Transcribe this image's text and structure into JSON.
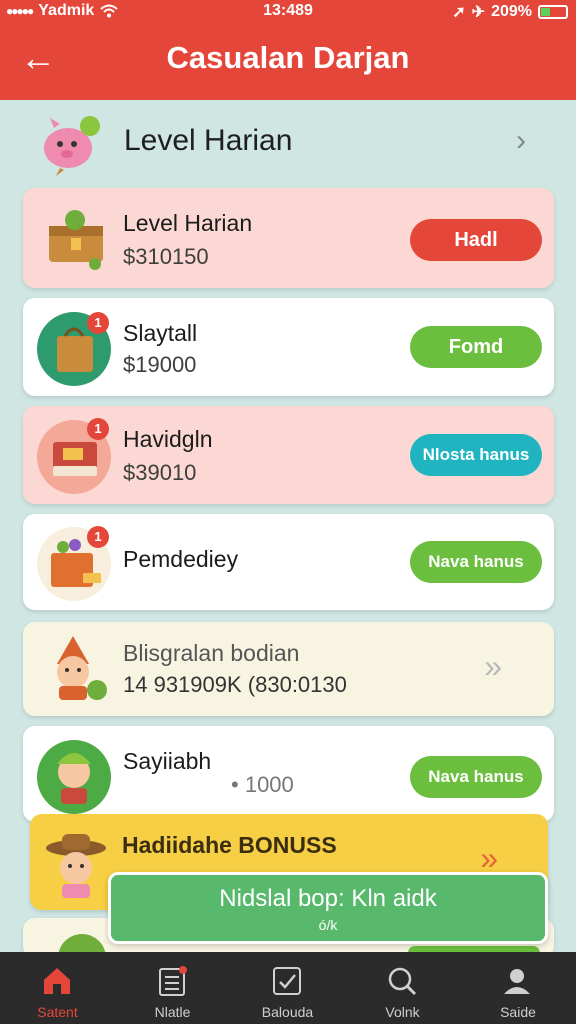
{
  "status_bar": {
    "carrier": "Yadmik",
    "time": "13:489",
    "battery": "209%"
  },
  "header": {
    "title": "Casualan Darjan",
    "back_label": "←"
  },
  "section": {
    "title": "Level Harian",
    "chevron": "›"
  },
  "cards": [
    {
      "title": "Level Harian",
      "sub": "$310150",
      "button": "Hadl"
    },
    {
      "title": "Slaytall",
      "sub": "$19000",
      "button": "Fomd"
    },
    {
      "title": "Havidgln",
      "sub": "$39010",
      "button": "Nlosta hanus"
    },
    {
      "title": "Pemdediey",
      "button": "Nava hanus"
    },
    {
      "title": "Blisgralan bodian",
      "sub": "14 931909K (830:0130",
      "chevron": "»"
    },
    {
      "title": "Sayiiabh",
      "sub": "1000",
      "button": "Nava hanus"
    },
    {
      "title": "Hadiidahe BONUSS",
      "chevron": "»"
    }
  ],
  "toast": {
    "title": "Nidslal bop: Kln aidk",
    "sub": "ó/k"
  },
  "badges": [
    "1",
    "1",
    "1"
  ],
  "bottom_nav": [
    {
      "label": "Satent",
      "icon": "home-icon"
    },
    {
      "label": "Nlatle",
      "icon": "list-icon"
    },
    {
      "label": "Balouda",
      "icon": "checkbox-icon"
    },
    {
      "label": "Volnk",
      "icon": "search-icon"
    },
    {
      "label": "Saide",
      "icon": "user-icon"
    }
  ],
  "colors": {
    "header": "#e5463a",
    "background": "#cfe6e3",
    "pink_card": "#fbd8d4",
    "white_card": "#ffffff",
    "cream_card": "#f8f4e2",
    "yellow_card": "#f6cf45",
    "red_pill": "#e5463a",
    "green_pill": "#6cbf3e",
    "teal_pill": "#1fb4c0",
    "toast_green": "#58b86c",
    "nav_bg": "#2b2b2b",
    "nav_active": "#e5463a"
  }
}
